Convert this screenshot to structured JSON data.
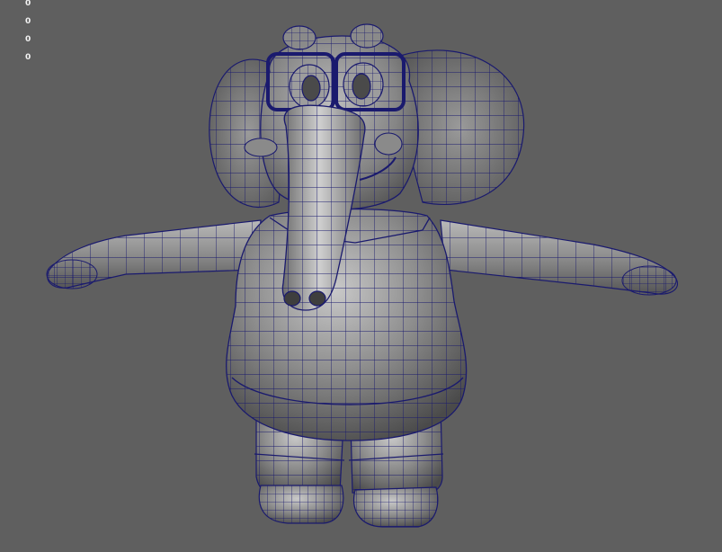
{
  "viewport": {
    "background": "#5f5f5f",
    "wire_color": "#1a1a6e",
    "mesh_color": "#8a8a8a"
  },
  "hud": {
    "stats": [
      "0",
      "0",
      "0",
      "0"
    ]
  },
  "model": {
    "name_icon": "elephant-character-icon"
  }
}
